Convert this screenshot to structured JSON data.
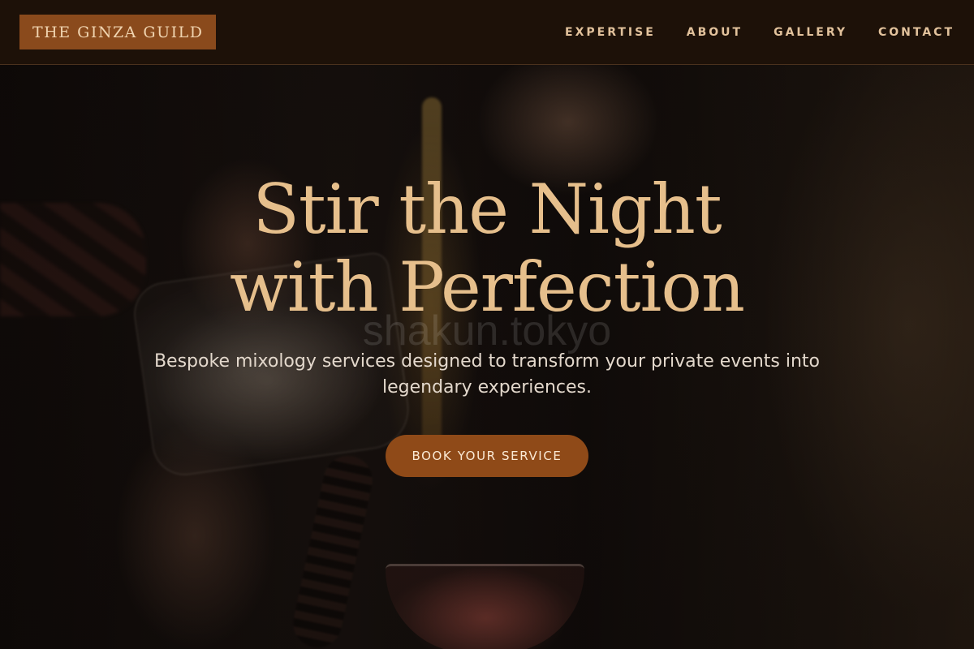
{
  "header": {
    "logo": "THE GINZA GUILD",
    "nav": [
      {
        "label": "EXPERTISE"
      },
      {
        "label": "ABOUT"
      },
      {
        "label": "GALLERY"
      },
      {
        "label": "CONTACT"
      }
    ]
  },
  "hero": {
    "headline_line1": "Stir the Night",
    "headline_line2": "with Perfection",
    "subtitle": "Bespoke mixology services designed to transform your private events into legendary experiences.",
    "cta_label": "BOOK YOUR SERVICE",
    "watermark": "shakun.tokyo"
  },
  "colors": {
    "header_bg": "#1d1108",
    "accent": "#8f4a18",
    "headline": "#e6bf8c",
    "nav_text": "#e2c29c"
  }
}
